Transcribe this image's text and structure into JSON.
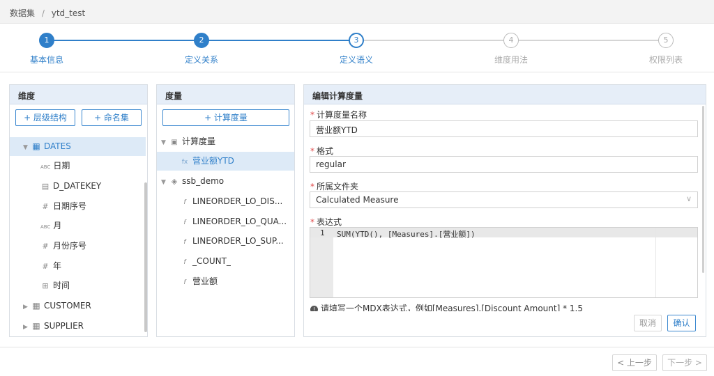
{
  "breadcrumb": {
    "root": "数据集",
    "separator": "/",
    "current": "ytd_test"
  },
  "steps": [
    {
      "num": "1",
      "label": "基本信息",
      "state": "done"
    },
    {
      "num": "2",
      "label": "定义关系",
      "state": "done"
    },
    {
      "num": "3",
      "label": "定义语义",
      "state": "current"
    },
    {
      "num": "4",
      "label": "维度用法",
      "state": "todo"
    },
    {
      "num": "5",
      "label": "权限列表",
      "state": "todo"
    }
  ],
  "dimension_panel": {
    "title": "维度",
    "add_hierarchy": "+ 层级结构",
    "add_named_set": "+ 命名集",
    "tree": [
      {
        "label": "DATES",
        "icon": "table-icon",
        "glyph": "▦",
        "expanded": true,
        "selected": true
      },
      {
        "label": "日期",
        "icon": "text-type-icon",
        "glyph": "ABC"
      },
      {
        "label": "D_DATEKEY",
        "icon": "calendar-icon",
        "glyph": "▤"
      },
      {
        "label": "日期序号",
        "icon": "number-type-icon",
        "glyph": "#"
      },
      {
        "label": "月",
        "icon": "text-type-icon",
        "glyph": "ABC"
      },
      {
        "label": "月份序号",
        "icon": "number-type-icon",
        "glyph": "#"
      },
      {
        "label": "年",
        "icon": "number-type-icon",
        "glyph": "#"
      },
      {
        "label": "时间",
        "icon": "hierarchy-icon",
        "glyph": "⊞"
      },
      {
        "label": "CUSTOMER",
        "icon": "table-icon",
        "glyph": "▦",
        "expanded": false
      },
      {
        "label": "SUPPLIER",
        "icon": "table-icon",
        "glyph": "▦",
        "expanded": false
      }
    ]
  },
  "measure_panel": {
    "title": "度量",
    "add_calculated": "+ 计算度量",
    "tree": [
      {
        "label": "计算度量",
        "icon": "folder-image-icon",
        "glyph": "▣",
        "expanded": true
      },
      {
        "label": "营业额YTD",
        "icon": "function-icon",
        "glyph": "fx",
        "selected": true
      },
      {
        "label": "ssb_demo",
        "icon": "cube-icon",
        "glyph": "◈",
        "expanded": true
      },
      {
        "label": "LINEORDER_LO_DIS...",
        "icon": "measure-icon",
        "glyph": "f"
      },
      {
        "label": "LINEORDER_LO_QUA...",
        "icon": "measure-icon",
        "glyph": "f"
      },
      {
        "label": "LINEORDER_LO_SUP...",
        "icon": "measure-icon",
        "glyph": "f"
      },
      {
        "label": "_COUNT_",
        "icon": "measure-icon",
        "glyph": "f"
      },
      {
        "label": "营业额",
        "icon": "measure-icon",
        "glyph": "f"
      }
    ]
  },
  "edit_panel": {
    "title": "编辑计算度量",
    "name_label": "计算度量名称",
    "name_value": "营业额YTD",
    "format_label": "格式",
    "format_value": "regular",
    "folder_label": "所属文件夹",
    "folder_value": "Calculated Measure",
    "expression_label": "表达式",
    "expression_line_num": "1",
    "expression_value": "SUM(YTD(), [Measures].[营业额])",
    "hint": "请填写一个MDX表达式，例如[Measures].[Discount Amount] * 1.5",
    "cancel": "取消",
    "confirm": "确认"
  },
  "footer": {
    "prev": "< 上一步",
    "next": "下一步 >"
  }
}
